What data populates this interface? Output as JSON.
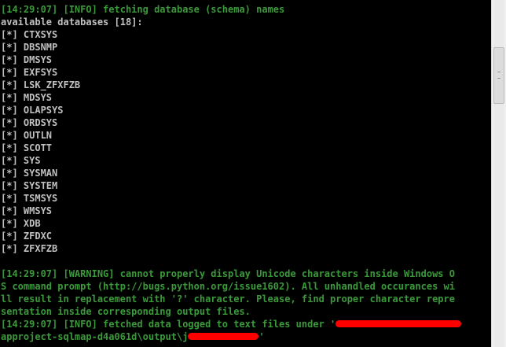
{
  "console": {
    "lines": [
      {
        "text": "[14:29:07] [INFO] fetching database (schema) names",
        "style": "green"
      },
      {
        "text": "available databases [18]:",
        "style": "gray"
      },
      {
        "text": "[*] CTXSYS",
        "style": "gray"
      },
      {
        "text": "[*] DBSNMP",
        "style": "gray"
      },
      {
        "text": "[*] DMSYS",
        "style": "gray"
      },
      {
        "text": "[*] EXFSYS",
        "style": "gray"
      },
      {
        "text": "[*] LSK_ZFXFZB",
        "style": "gray"
      },
      {
        "text": "[*] MDSYS",
        "style": "gray"
      },
      {
        "text": "[*] OLAPSYS",
        "style": "gray"
      },
      {
        "text": "[*] ORDSYS",
        "style": "gray"
      },
      {
        "text": "[*] OUTLN",
        "style": "gray"
      },
      {
        "text": "[*] SCOTT",
        "style": "gray"
      },
      {
        "text": "[*] SYS",
        "style": "gray"
      },
      {
        "text": "[*] SYSMAN",
        "style": "gray"
      },
      {
        "text": "[*] SYSTEM",
        "style": "gray"
      },
      {
        "text": "[*] TSMSYS",
        "style": "gray"
      },
      {
        "text": "[*] WMSYS",
        "style": "gray"
      },
      {
        "text": "[*] XDB",
        "style": "gray"
      },
      {
        "text": "[*] ZFDXC",
        "style": "gray"
      },
      {
        "text": "[*] ZFXFZB",
        "style": "gray"
      },
      {
        "text": "",
        "style": "gray"
      },
      {
        "text": "[14:29:07] [WARNING] cannot properly display Unicode characters inside Windows O",
        "style": "green"
      },
      {
        "text": "S command prompt (http://bugs.python.org/issue1602). All unhandled occurances wi",
        "style": "green"
      },
      {
        "text": "ll result in replacement with '?' character. Please, find proper character repre",
        "style": "green"
      },
      {
        "text": "sentation inside corresponding output files.",
        "style": "green"
      },
      {
        "text": "[14:29:07] [INFO] fetched data logged to text files under '",
        "style": "green",
        "redact_width": 160
      },
      {
        "text": "approject-sqlmap-d4a061d\\output\\j",
        "style": "green",
        "redact_width": 90,
        "suffix": "'"
      }
    ]
  },
  "colors": {
    "background": "#000000",
    "green_text": "#3a9a3a",
    "gray_text": "#c0c0c0",
    "redaction": "#ff0000"
  }
}
